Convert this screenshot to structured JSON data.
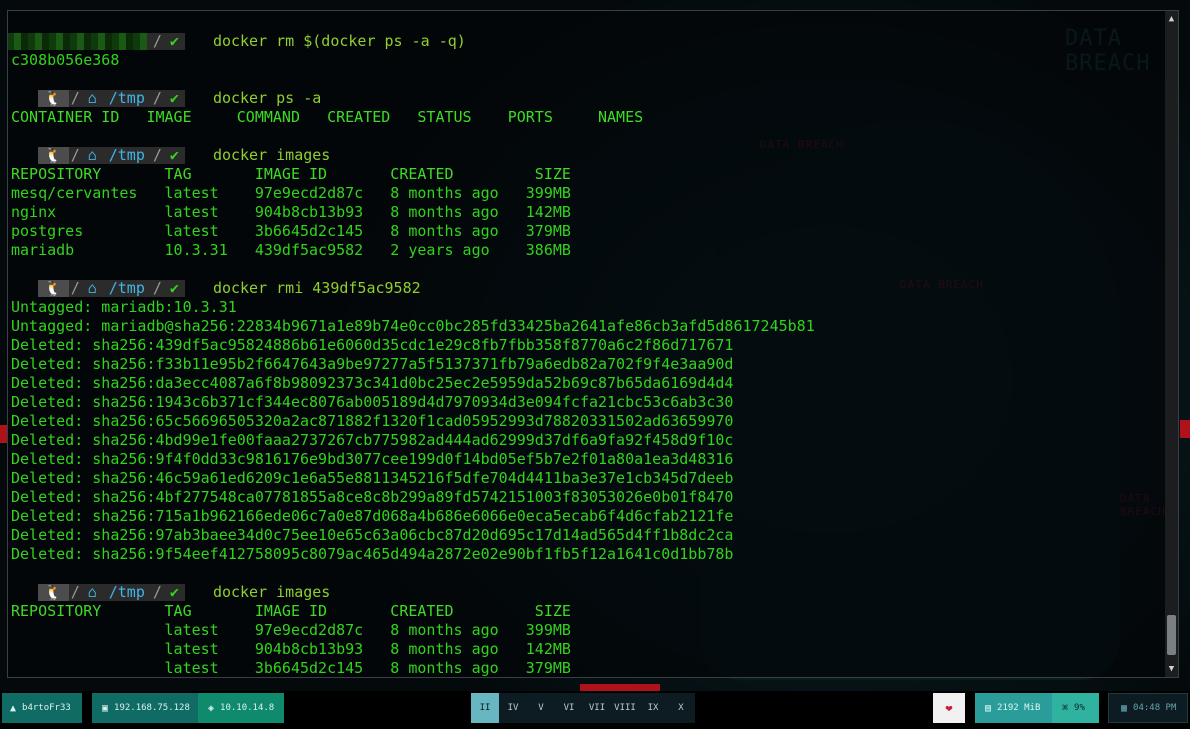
{
  "prompt": {
    "linux_icon": "🐧",
    "sep": "/",
    "home_icon": "⌂",
    "dir": "/tmp",
    "ok": "✔"
  },
  "blocks": [
    {
      "cmd": "docker rm $(docker ps -a -q)",
      "output": [
        "c308b056e368"
      ]
    },
    {
      "cmd": "docker ps -a",
      "header": "CONTAINER ID   IMAGE     COMMAND   CREATED   STATUS    PORTS     NAMES",
      "output": []
    },
    {
      "cmd": "docker images",
      "header": "REPOSITORY       TAG       IMAGE ID       CREATED         SIZE",
      "output": [
        "mesq/cervantes   latest    97e9ecd2d87c   8 months ago   399MB",
        "nginx            latest    904b8cb13b93   8 months ago   142MB",
        "postgres         latest    3b6645d2c145   8 months ago   379MB",
        "mariadb          10.3.31   439df5ac9582   2 years ago    386MB"
      ]
    },
    {
      "cmd": "docker rmi 439df5ac9582",
      "output": [
        "Untagged: mariadb:10.3.31",
        "Untagged: mariadb@sha256:22834b9671a1e89b74e0cc0bc285fd33425ba2641afe86cb3afd5d8617245b81",
        "Deleted: sha256:439df5ac95824886b61e6060d35cdc1e29c8fb7fbb358f8770a6c2f86d717671",
        "Deleted: sha256:f33b11e95b2f6647643a9be97277a5f5137371fb79a6edb82a702f9f4e3aa90d",
        "Deleted: sha256:da3ecc4087a6f8b98092373c341d0bc25ec2e5959da52b69c87b65da6169d4d4",
        "Deleted: sha256:1943c6b371cf344ec8076ab005189d4d7970934d3e094fcfa21cbc53c6ab3c30",
        "Deleted: sha256:65c56696505320a2ac871882f1320f1cad05952993d78820331502ad63659970",
        "Deleted: sha256:4bd99e1fe00faaa2737267cb775982ad444ad62999d37df6a9fa92f458d9f10c",
        "Deleted: sha256:9f4f0dd33c9816176e9bd3077cee199d0f14bd05ef5b7e2f01a80a1ea3d48316",
        "Deleted: sha256:46c59a61ed6209c1e6a55e8811345216f5dfe704d4411ba3e37e1cb345d7deeb",
        "Deleted: sha256:4bf277548ca07781855a8ce8c8b299a89fd5742151003f83053026e0b01f8470",
        "Deleted: sha256:715a1b962166ede06c7a0e87d068a4b686e6066e0eca5ecab6f4d6cfab2121fe",
        "Deleted: sha256:97ab3baee34d0c75ee10e65c63a06cbc87d20d695c17d14ad565d4ff1b8dc2ca",
        "Deleted: sha256:9f54eef412758095c8079ac465d494a2872e02e90bf1fb5f12a1641c0d1bb78b"
      ]
    },
    {
      "cmd": "docker images",
      "header": "REPOSITORY       TAG       IMAGE ID       CREATED         SIZE",
      "output_redacted": [
        "                 latest    97e9ecd2d87c   8 months ago   399MB",
        "                 latest    904b8cb13b93   8 months ago   142MB",
        "                 latest    3b6645d2c145   8 months ago   379MB"
      ]
    }
  ],
  "taskbar": {
    "user": "b4rtoFr33",
    "ip_local": "192.168.75.128",
    "ip_vpn": "10.10.14.8",
    "workspaces": [
      "II",
      "IV",
      "V",
      "VI",
      "VII",
      "VIII",
      "IX",
      "X"
    ],
    "active_workspace": "II",
    "memory": "2192 MiB",
    "cpu": "9%",
    "time": "04:48 PM"
  },
  "background_text": [
    "DATA BREACH"
  ],
  "colors": {
    "terminal_green": "#32d31c",
    "path_blue": "#3fb6e8",
    "accent_teal": "#0f6b63"
  }
}
